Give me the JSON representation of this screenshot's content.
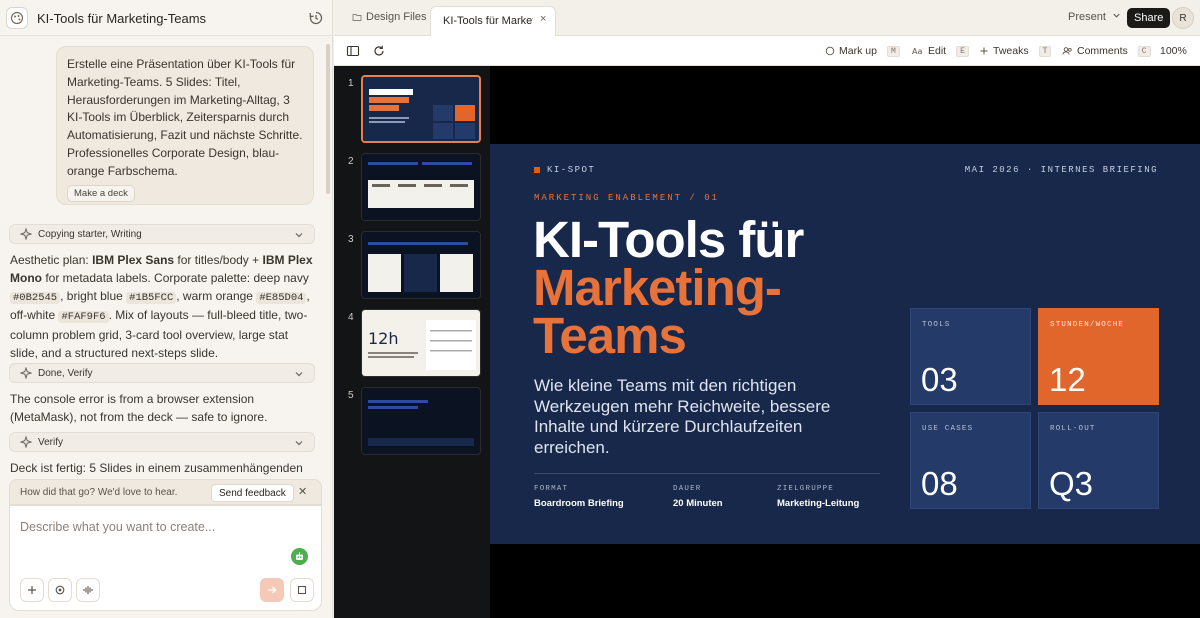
{
  "project": {
    "title": "KI-Tools für Marketing-Teams"
  },
  "chat": {
    "user_message": "Erstelle eine Präsentation über KI-Tools für Marketing-Teams. 5 Slides: Titel, Herausforderungen im Marketing-Alltag, 3 KI-Tools im Überblick, Zeitersparnis durch Automatisierung, Fazit und nächste Schritte. Professionelles Corporate Design, blau-orange Farbschema.",
    "make_deck_chip": "Make a deck",
    "steps": [
      {
        "label": "Copying starter, Writing"
      },
      {
        "label": "Done, Verify"
      },
      {
        "label": "Verify"
      }
    ],
    "aesthetic": {
      "p1": "Aesthetic plan: ",
      "font1": "IBM Plex Sans",
      "p2": " for titles/body + ",
      "font2": "IBM Plex Mono",
      "p3": " for metadata labels. Corporate palette: deep navy ",
      "c1": "#0B2545",
      "p4": ", bright blue ",
      "c2": "#1B5FCC",
      "p5": ", warm orange ",
      "c3": "#E85D04",
      "p6": ", off-white ",
      "c4": "#FAF9F6",
      "p7": ". Mix of layouts — full-bleed title, two-column problem grid, 3-card tool overview, large stat slide, and a structured next-steps slide."
    },
    "console_note": "The console error is from a browser extension (MetaMask), not from the deck — safe to ignore.",
    "final_note": "Deck ist fertig: 5 Slides in einem zusammenhängenden"
  },
  "feedback": {
    "question": "How did that go? We'd love to hear.",
    "send_label": "Send feedback",
    "close": "✕"
  },
  "composer": {
    "placeholder": "Describe what you want to create..."
  },
  "tabs": {
    "design_files": "Design Files",
    "active": "KI-Tools für Marketing-Teams",
    "close": "×"
  },
  "header": {
    "present": "Present",
    "share": "Share",
    "avatar": "R"
  },
  "toolbar": {
    "markup": "Mark up",
    "markup_key": "M",
    "edit": "Edit",
    "edit_key": "E",
    "tweaks": "Tweaks",
    "tweaks_key": "T",
    "comments": "Comments",
    "comments_key": "C",
    "zoom": "100%"
  },
  "thumbnails": [
    {
      "num": "1",
      "active": true
    },
    {
      "num": "2",
      "active": false
    },
    {
      "num": "3",
      "active": false
    },
    {
      "num": "4",
      "active": false
    },
    {
      "num": "5",
      "active": false
    }
  ],
  "slide": {
    "brand": "KI-SPOT",
    "date": "MAI 2026 · INTERNES BRIEFING",
    "eyebrow": "MARKETING ENABLEMENT / 01",
    "title_line1": "KI-Tools für",
    "title_accent1": "Marketing-",
    "title_accent2": "Teams",
    "subtitle": "Wie kleine Teams mit den richtigen Werkzeugen mehr Reichweite, bessere Inhalte und kürzere Durchlaufzeiten erreichen.",
    "meta": [
      {
        "label": "FORMAT",
        "value": "Boardroom Briefing"
      },
      {
        "label": "DAUER",
        "value": "20 Minuten"
      },
      {
        "label": "ZIELGRUPPE",
        "value": "Marketing-Leitung"
      }
    ],
    "stats": [
      {
        "label": "TOOLS",
        "value": "03"
      },
      {
        "label": "STUNDEN/WOCHE",
        "value": "12"
      },
      {
        "label": "USE CASES",
        "value": "08"
      },
      {
        "label": "ROLL-OUT",
        "value": "Q3"
      }
    ]
  },
  "colors": {
    "navy": "#17284a",
    "orange": "#e0662b",
    "stat_blue": "#243a68"
  }
}
